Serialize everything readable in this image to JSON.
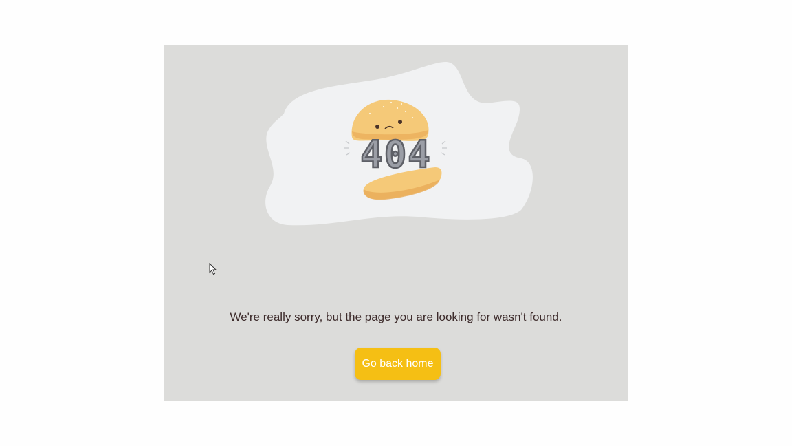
{
  "illustration": {
    "code_text": "404",
    "colors": {
      "blob": "#f1f2f3",
      "bun": "#f5c978",
      "bun_dark": "#e9ab57",
      "digits_fill": "#9b9ea6",
      "digits_stroke": "#5e6067"
    }
  },
  "message": "We're really sorry, but the page you are looking for wasn't found.",
  "home_button": {
    "label": "Go back home",
    "color": "#f5bf14"
  },
  "colors": {
    "card_background": "#dcdcda",
    "text": "#3d2b2b"
  }
}
